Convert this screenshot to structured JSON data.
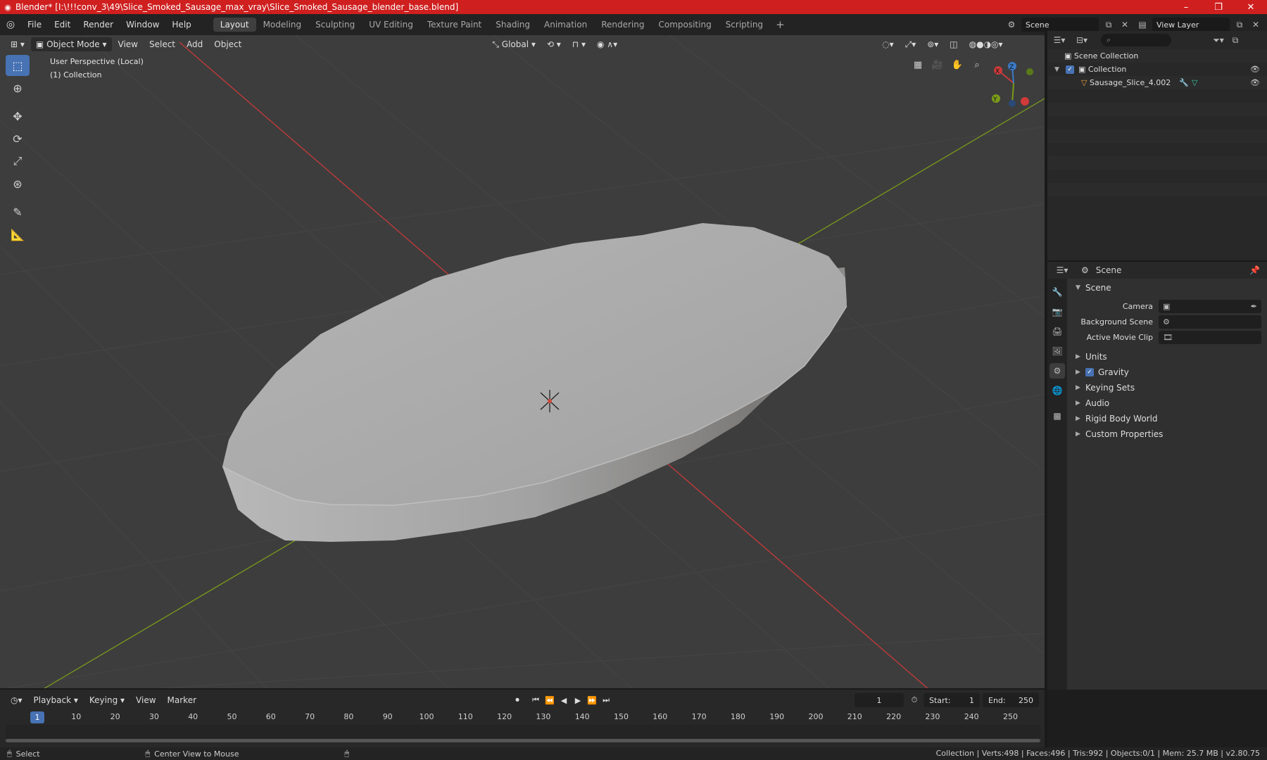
{
  "window": {
    "title": "Blender* [I:\\!!!conv_3\\49\\Slice_Smoked_Sausage_max_vray\\Slice_Smoked_Sausage_blender_base.blend]",
    "minimize": "–",
    "maximize": "❐",
    "close": "✕"
  },
  "menu": [
    "File",
    "Edit",
    "Render",
    "Window",
    "Help"
  ],
  "workspaces": [
    "Layout",
    "Modeling",
    "Sculpting",
    "UV Editing",
    "Texture Paint",
    "Shading",
    "Animation",
    "Rendering",
    "Compositing",
    "Scripting"
  ],
  "active_workspace": "Layout",
  "top_right": {
    "scene": "Scene",
    "view_layer": "View Layer"
  },
  "viewport": {
    "mode": "Object Mode",
    "menus": [
      "View",
      "Select",
      "Add",
      "Object"
    ],
    "transform": "Global",
    "info_line1": "User Perspective (Local)",
    "info_line2": "(1) Collection"
  },
  "gizmo": {
    "x": "X",
    "y": "Y",
    "z": "Z"
  },
  "outliner": {
    "root": "Scene Collection",
    "collection": "Collection",
    "object": "Sausage_Slice_4.002"
  },
  "properties": {
    "header": "Scene",
    "panel": "Scene",
    "fields": [
      {
        "label": "Camera",
        "value": ""
      },
      {
        "label": "Background Scene",
        "value": ""
      },
      {
        "label": "Active Movie Clip",
        "value": ""
      }
    ],
    "sections": [
      "Units",
      "Gravity",
      "Keying Sets",
      "Audio",
      "Rigid Body World",
      "Custom Properties"
    ],
    "gravity_checked": true
  },
  "timeline": {
    "menus": [
      "Playback",
      "Keying",
      "View",
      "Marker"
    ],
    "current_frame": "1",
    "start_label": "Start:",
    "start": "1",
    "end_label": "End:",
    "end": "250",
    "ticks": [
      "10",
      "20",
      "30",
      "40",
      "50",
      "60",
      "70",
      "80",
      "90",
      "100",
      "110",
      "120",
      "130",
      "140",
      "150",
      "160",
      "170",
      "180",
      "190",
      "200",
      "210",
      "220",
      "230",
      "240",
      "250"
    ]
  },
  "statusbar": {
    "select": "Select",
    "center": "Center View to Mouse",
    "stats": "Collection | Verts:498 | Faces:496 | Tris:992 | Objects:0/1 | Mem: 25.7 MB | v2.80.75"
  },
  "colors": {
    "title_bar": "#cf1f1f",
    "accent": "#4772b3",
    "x_axis": "#c83a3a",
    "y_axis": "#7a9a1a"
  }
}
